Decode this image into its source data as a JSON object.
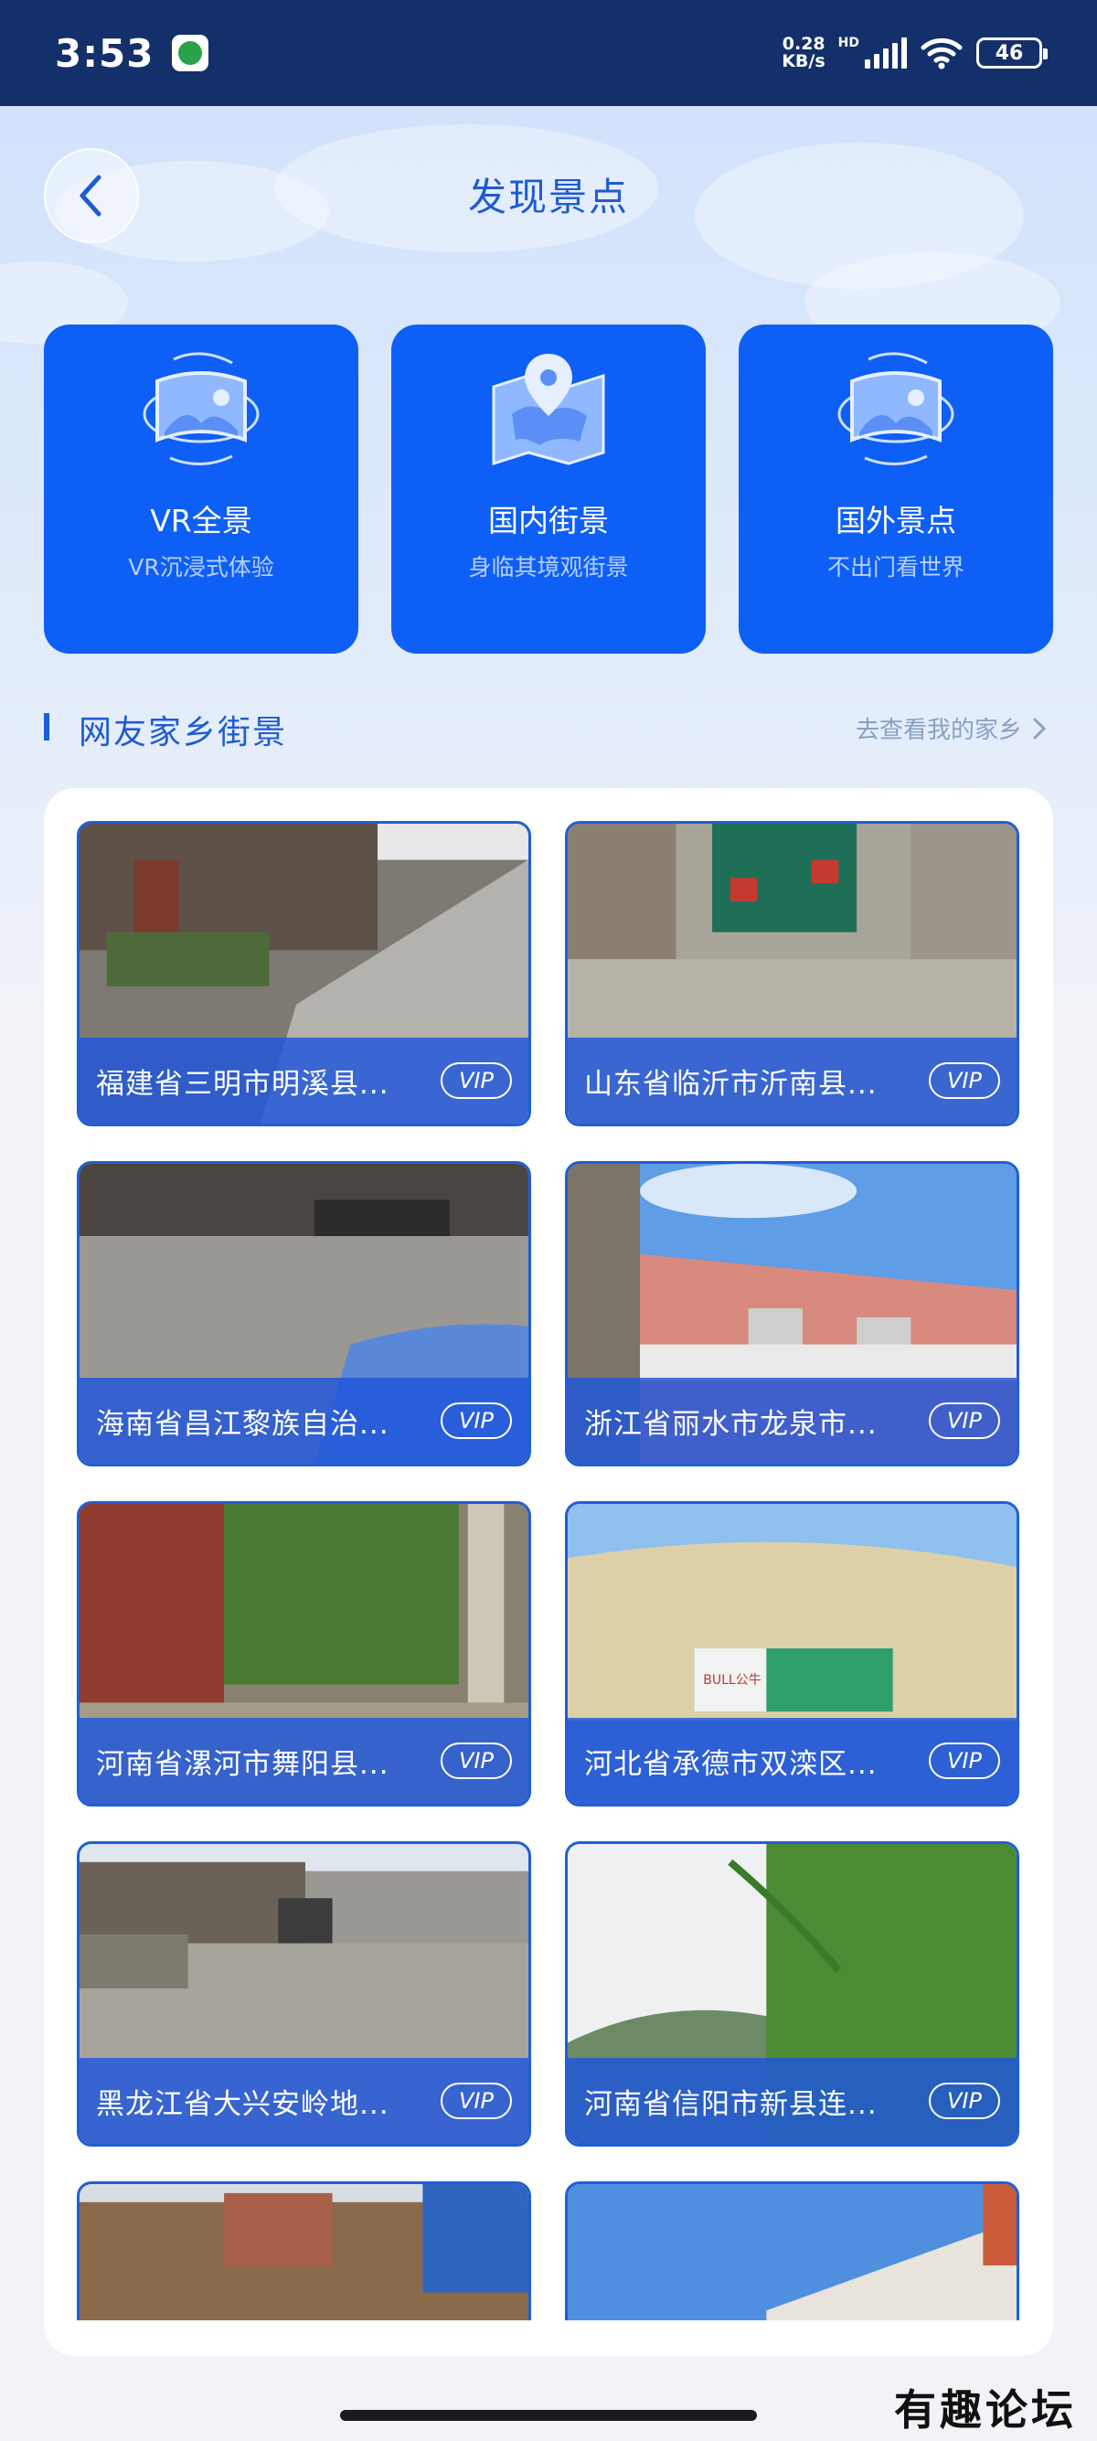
{
  "status": {
    "time": "3:53",
    "net_speed_top": "0.28",
    "net_speed_bottom": "KB/s",
    "hd": "HD",
    "battery": "46"
  },
  "header": {
    "title": "发现景点"
  },
  "features": [
    {
      "title": "VR全景",
      "subtitle": "VR沉浸式体验",
      "icon": "vr-panorama-icon"
    },
    {
      "title": "国内街景",
      "subtitle": "身临其境观街景",
      "icon": "map-pin-icon"
    },
    {
      "title": "国外景点",
      "subtitle": "不出门看世界",
      "icon": "vr-panorama-icon"
    }
  ],
  "section": {
    "title": "网友家乡街景",
    "link": "去查看我的家乡"
  },
  "cards": [
    {
      "caption": "福建省三明市明溪县...",
      "badge": "VIP"
    },
    {
      "caption": "山东省临沂市沂南县...",
      "badge": "VIP"
    },
    {
      "caption": "海南省昌江黎族自治...",
      "badge": "VIP"
    },
    {
      "caption": "浙江省丽水市龙泉市...",
      "badge": "VIP"
    },
    {
      "caption": "河南省漯河市舞阳县...",
      "badge": "VIP"
    },
    {
      "caption": "河北省承德市双滦区...",
      "badge": "VIP"
    },
    {
      "caption": "黑龙江省大兴安岭地...",
      "badge": "VIP"
    },
    {
      "caption": "河南省信阳市新县连...",
      "badge": "VIP"
    }
  ],
  "sign_text": "BULL公牛",
  "watermark": "有趣论坛"
}
